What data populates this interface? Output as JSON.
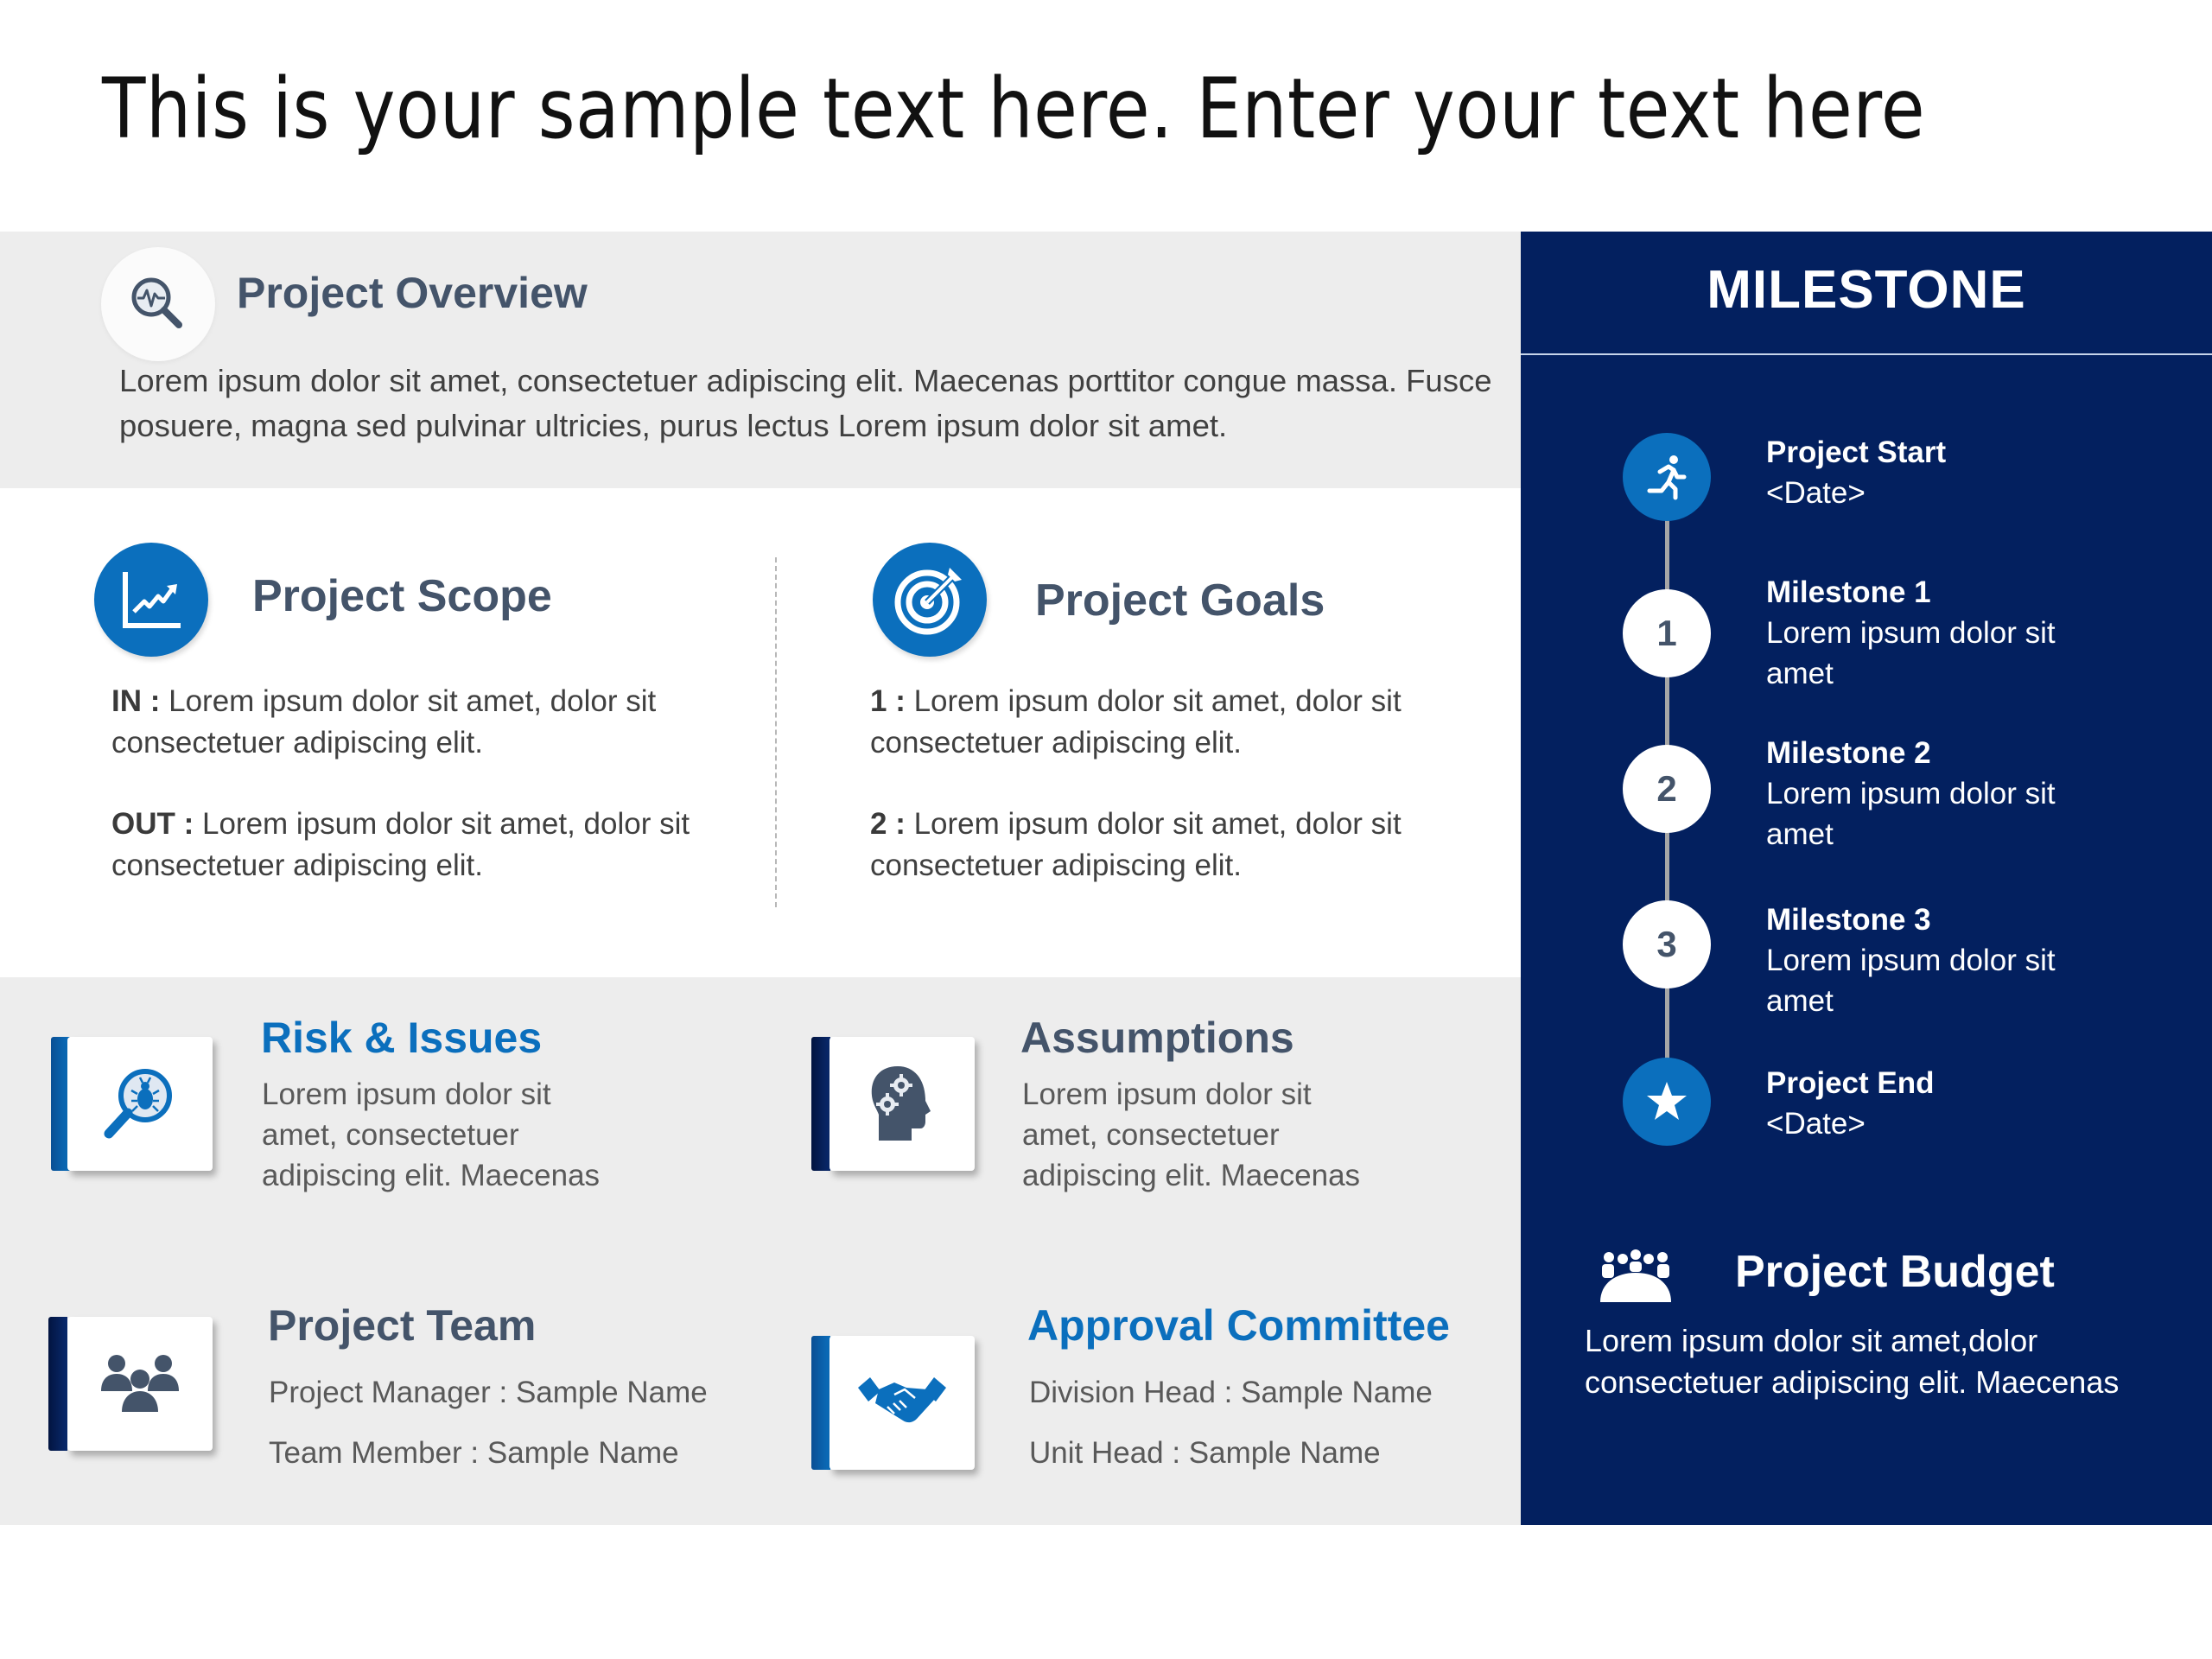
{
  "slide_title": "This is your sample text here. Enter your text here",
  "overview": {
    "icon": "magnifier-pulse-icon",
    "title": "Project Overview",
    "text": "Lorem ipsum dolor sit amet, consectetuer adipiscing elit. Maecenas porttitor congue massa. Fusce posuere, magna sed pulvinar ultricies, purus lectus Lorem ipsum dolor sit amet."
  },
  "scope": {
    "icon": "growth-chart-icon",
    "title": "Project Scope",
    "items": [
      {
        "label": "IN :",
        "text": " Lorem ipsum dolor sit amet, dolor sit consectetuer adipiscing elit."
      },
      {
        "label": "OUT :",
        "text": " Lorem ipsum dolor sit amet, dolor sit consectetuer adipiscing elit."
      }
    ]
  },
  "goals": {
    "icon": "target-icon",
    "title": "Project Goals",
    "items": [
      {
        "label": "1 :",
        "text": "  Lorem ipsum dolor sit amet, dolor sit consectetuer adipiscing elit."
      },
      {
        "label": "2 :",
        "text": " Lorem ipsum dolor sit amet, dolor sit consectetuer adipiscing elit."
      }
    ]
  },
  "risk": {
    "icon": "bug-search-icon",
    "title": "Risk & Issues",
    "text": "Lorem ipsum dolor sit amet, consectetuer adipiscing elit. Maecenas"
  },
  "assumptions": {
    "icon": "head-gears-icon",
    "title": "Assumptions",
    "text": "Lorem ipsum dolor sit amet, consectetuer adipiscing elit. Maecenas"
  },
  "team": {
    "icon": "people-group-icon",
    "title": "Project Team",
    "lines": [
      "Project Manager : Sample Name",
      "Team Member : Sample Name"
    ]
  },
  "approval": {
    "icon": "handshake-icon",
    "title": "Approval Committee",
    "lines": [
      "Division Head : Sample Name",
      "Unit Head : Sample Name"
    ]
  },
  "milestone": {
    "header": "MILESTONE",
    "nodes": [
      {
        "marker": "",
        "icon": "running-person-icon",
        "title": "Project Start",
        "text": "<Date>"
      },
      {
        "marker": "1",
        "icon": "",
        "title": "Milestone 1",
        "text": "Lorem ipsum dolor sit amet"
      },
      {
        "marker": "2",
        "icon": "",
        "title": "Milestone 2",
        "text": "Lorem ipsum dolor sit amet"
      },
      {
        "marker": "3",
        "icon": "",
        "title": "Milestone 3",
        "text": "Lorem ipsum dolor sit amet"
      },
      {
        "marker": "",
        "icon": "star-icon",
        "title": "Project End",
        "text": "<Date>"
      }
    ]
  },
  "budget": {
    "icon": "meeting-group-icon",
    "title": "Project Budget",
    "text": "Lorem ipsum dolor sit amet,dolor consectetuer adipiscing elit. Maecenas"
  },
  "colors": {
    "navy": "#03205f",
    "accent_blue": "#0b6fbd",
    "heading_slate": "#44546a",
    "panel_gray": "#ededed",
    "body_text": "#404040"
  }
}
